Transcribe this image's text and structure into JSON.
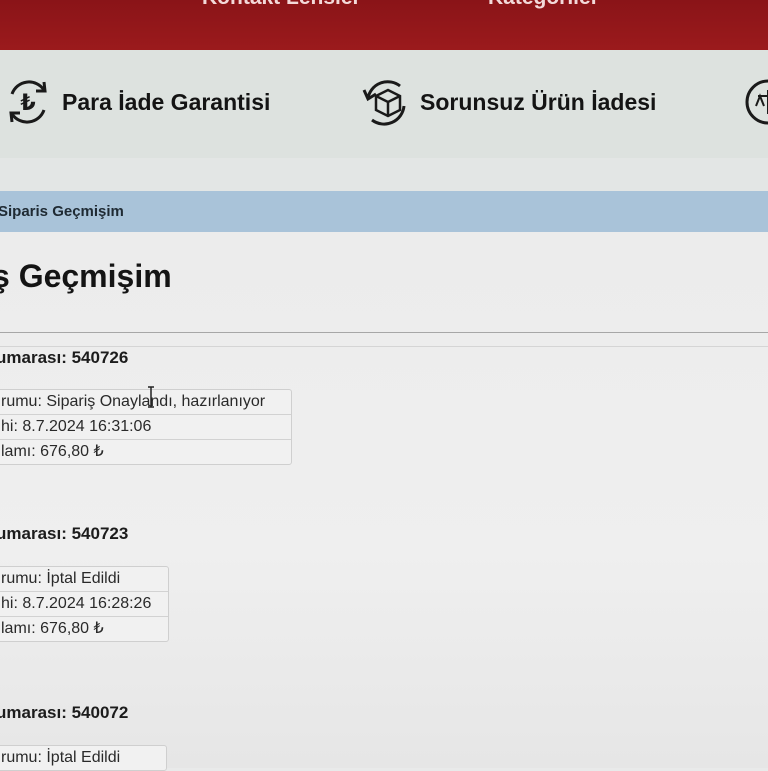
{
  "topnav": {
    "links": [
      "Kontakt Lensler",
      "Kategoriler"
    ]
  },
  "features": [
    {
      "label": "Para İade Garantisi",
      "icon": "lira-refund-icon"
    },
    {
      "label": "Sorunsuz Ürün İadesi",
      "icon": "box-return-icon"
    },
    {
      "label": "",
      "icon": "scale-icon"
    }
  ],
  "breadcrumb": "Siparis Geçmişim",
  "page_title": "ş Geçmişim",
  "orders": [
    {
      "title": "umarası: 540726",
      "status": "rumu: Sipariş Onaylandı, hazırlanıyor",
      "date": "hi: 8.7.2024 16:31:06",
      "total": "lamı: 676,80 ₺"
    },
    {
      "title": "umarası: 540723",
      "status": "rumu: İptal Edildi",
      "date": "hi: 8.7.2024 16:28:26",
      "total": "lamı: 676,80 ₺"
    },
    {
      "title": "umarası: 540072",
      "status": "rumu: İptal Edildi"
    }
  ],
  "colors": {
    "nav_red": "#8a1418",
    "breadcrumb_blue": "#a9c3d9"
  }
}
